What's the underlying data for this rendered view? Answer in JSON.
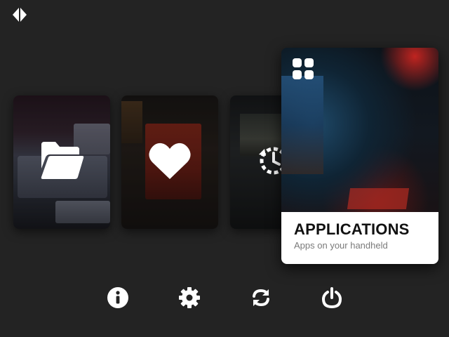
{
  "app": {
    "logo_icon": "diamond-split-logo-icon"
  },
  "tiles": [
    {
      "id": "roms",
      "icon": "folder-open-icon"
    },
    {
      "id": "favorites",
      "icon": "heart-icon"
    },
    {
      "id": "recent",
      "icon": "history-icon"
    },
    {
      "id": "applications",
      "icon": "apps-grid-icon",
      "title": "APPLICATIONS",
      "subtitle": "Apps on your handheld",
      "selected": true
    }
  ],
  "bottom_bar": {
    "buttons": [
      {
        "id": "info",
        "icon": "info-icon"
      },
      {
        "id": "settings",
        "icon": "gear-icon"
      },
      {
        "id": "sync",
        "icon": "sync-icon"
      },
      {
        "id": "power",
        "icon": "power-icon"
      }
    ]
  },
  "colors": {
    "background": "#232323",
    "caption_bg": "#ffffff",
    "title": "#111111",
    "subtitle": "#7a7a7a",
    "icon": "#ffffff"
  }
}
